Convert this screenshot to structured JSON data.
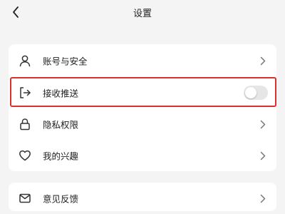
{
  "header": {
    "title": "设置",
    "back_icon": "chevron-left-icon"
  },
  "settings": {
    "items": [
      {
        "label": "账号与安全",
        "icon": "user-icon",
        "control": "chevron"
      },
      {
        "label": "接收推送",
        "icon": "logout-arrow-icon",
        "control": "toggle",
        "toggle_on": false,
        "highlighted": true
      },
      {
        "label": "隐私权限",
        "icon": "lock-icon",
        "control": "chevron"
      },
      {
        "label": "我的兴趣",
        "icon": "heart-icon",
        "control": "chevron"
      },
      {
        "label": "意见反馈",
        "icon": "mail-icon",
        "control": "chevron"
      }
    ]
  },
  "colors": {
    "background": "#f4f4f4",
    "card": "#ffffff",
    "highlight_border": "#d9312b",
    "toggle_off": "#e6e6e6"
  }
}
